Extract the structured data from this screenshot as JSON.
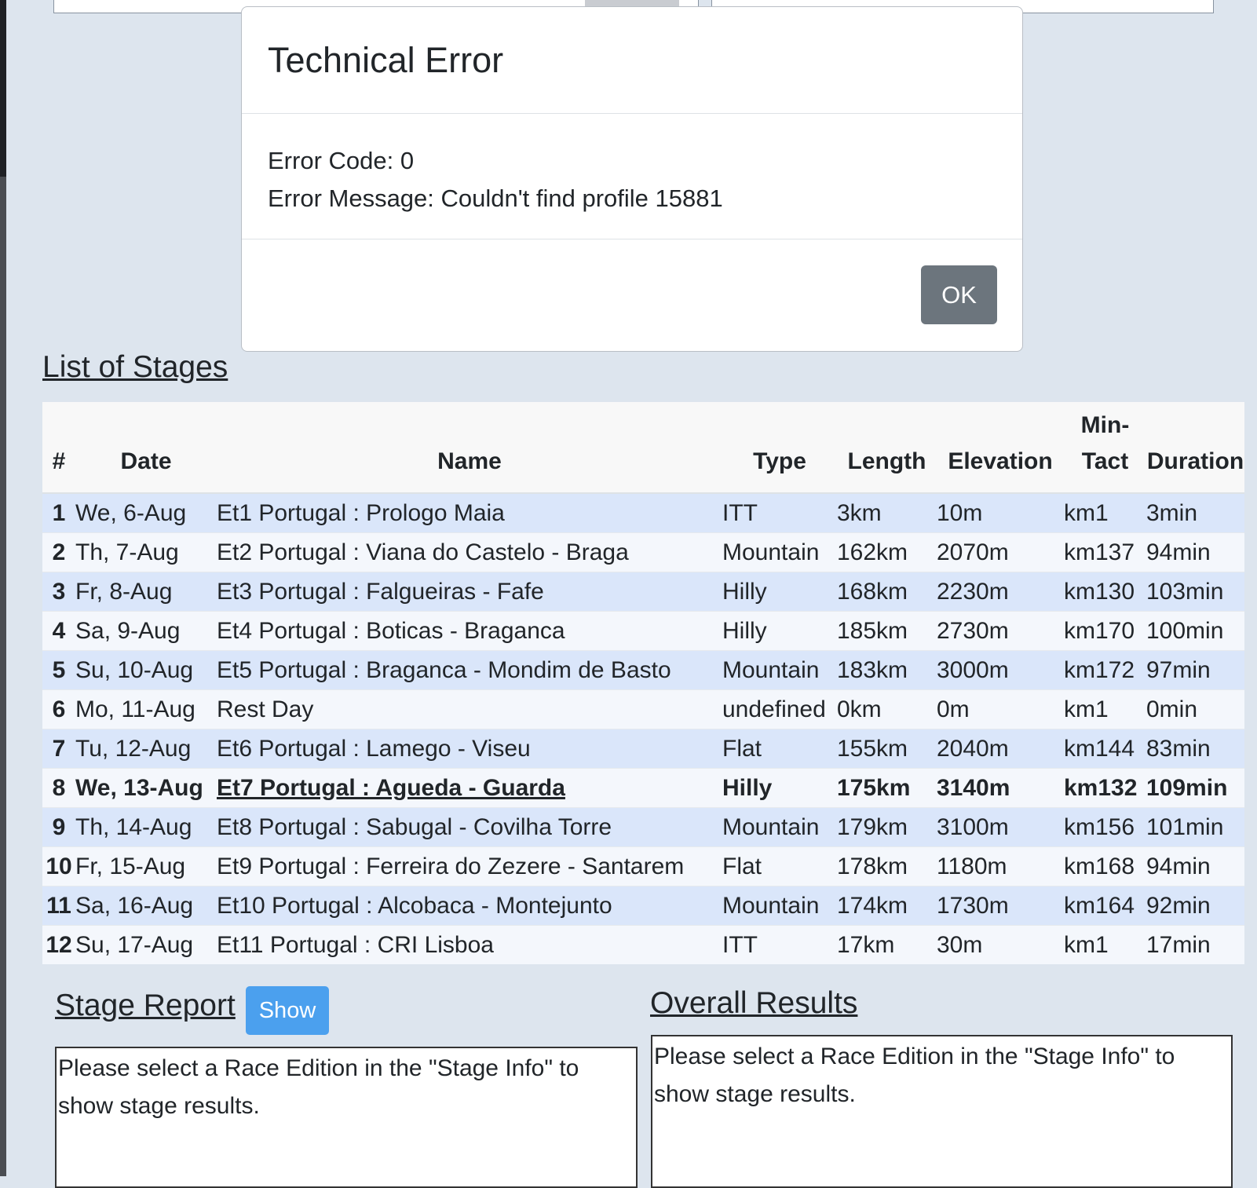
{
  "modal": {
    "title": "Technical Error",
    "error_code": "Error Code: 0",
    "error_message": "Error Message: Couldn't find profile 15881",
    "ok_label": "OK"
  },
  "stages": {
    "heading": "List of Stages",
    "columns": [
      "#",
      "Date",
      "Name",
      "Type",
      "Length",
      "Elevation",
      "Min-\nTact",
      "Duration"
    ],
    "rows": [
      {
        "num": "1",
        "date": "We, 6-Aug",
        "name": "Et1 Portugal : Prologo Maia",
        "type": "ITT",
        "length": "3km",
        "elevation": "10m",
        "tact": "km1",
        "duration": "3min"
      },
      {
        "num": "2",
        "date": "Th, 7-Aug",
        "name": "Et2 Portugal : Viana do Castelo - Braga",
        "type": "Mountain",
        "length": "162km",
        "elevation": "2070m",
        "tact": "km137",
        "duration": "94min"
      },
      {
        "num": "3",
        "date": "Fr, 8-Aug",
        "name": "Et3 Portugal : Falgueiras - Fafe",
        "type": "Hilly",
        "length": "168km",
        "elevation": "2230m",
        "tact": "km130",
        "duration": "103min"
      },
      {
        "num": "4",
        "date": "Sa, 9-Aug",
        "name": "Et4 Portugal : Boticas - Braganca",
        "type": "Hilly",
        "length": "185km",
        "elevation": "2730m",
        "tact": "km170",
        "duration": "100min"
      },
      {
        "num": "5",
        "date": "Su, 10-Aug",
        "name": "Et5 Portugal : Braganca - Mondim de Basto",
        "type": "Mountain",
        "length": "183km",
        "elevation": "3000m",
        "tact": "km172",
        "duration": "97min"
      },
      {
        "num": "6",
        "date": "Mo, 11-Aug",
        "name": "Rest Day",
        "type": "undefined",
        "length": "0km",
        "elevation": "0m",
        "tact": "km1",
        "duration": "0min"
      },
      {
        "num": "7",
        "date": "Tu, 12-Aug",
        "name": "Et6 Portugal : Lamego - Viseu",
        "type": "Flat",
        "length": "155km",
        "elevation": "2040m",
        "tact": "km144",
        "duration": "83min"
      },
      {
        "num": "8",
        "date": "We, 13-Aug",
        "name": "Et7 Portugal : Agueda - Guarda",
        "type": "Hilly",
        "length": "175km",
        "elevation": "3140m",
        "tact": "km132",
        "duration": "109min"
      },
      {
        "num": "9",
        "date": "Th, 14-Aug",
        "name": "Et8 Portugal : Sabugal - Covilha Torre",
        "type": "Mountain",
        "length": "179km",
        "elevation": "3100m",
        "tact": "km156",
        "duration": "101min"
      },
      {
        "num": "10",
        "date": "Fr, 15-Aug",
        "name": "Et9 Portugal : Ferreira do Zezere - Santarem",
        "type": "Flat",
        "length": "178km",
        "elevation": "1180m",
        "tact": "km168",
        "duration": "94min"
      },
      {
        "num": "11",
        "date": "Sa, 16-Aug",
        "name": "Et10 Portugal : Alcobaca - Montejunto",
        "type": "Mountain",
        "length": "174km",
        "elevation": "1730m",
        "tact": "km164",
        "duration": "92min"
      },
      {
        "num": "12",
        "date": "Su, 17-Aug",
        "name": "Et11 Portugal : CRI Lisboa",
        "type": "ITT",
        "length": "17km",
        "elevation": "30m",
        "tact": "km1",
        "duration": "17min"
      }
    ],
    "current_row": 7
  },
  "stage_report": {
    "heading": "Stage Report",
    "show_label": "Show",
    "text": "Please select a Race Edition in the \"Stage Info\" to show stage results."
  },
  "overall_results": {
    "heading": "Overall Results",
    "text": "Please select a Race Edition in the \"Stage Info\" to show stage results."
  },
  "colors": {
    "row_odd": "#dae6fa",
    "row_even": "#f4f7fc",
    "ok_button": "#6c757d",
    "show_button": "#4ba0ee"
  }
}
